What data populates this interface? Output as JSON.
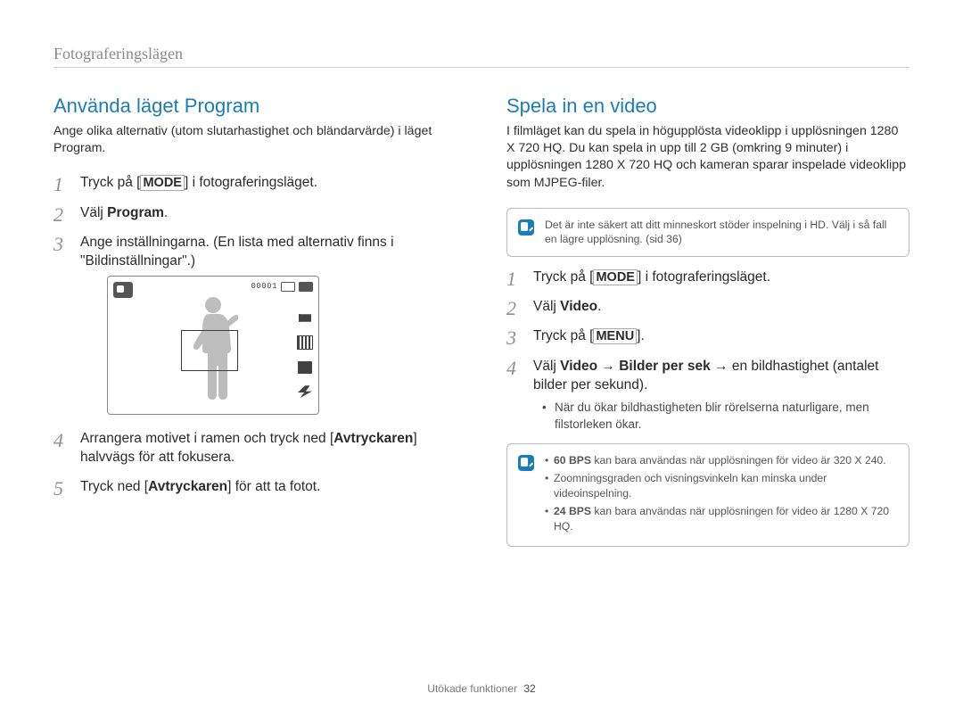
{
  "section_title": "Fotograferingslägen",
  "left": {
    "heading": "Använda läget Program",
    "lead": "Ange olika alternativ (utom slutarhastighet och bländarvärde) i läget Program.",
    "steps": {
      "s1_pre": "Tryck på [",
      "s1_framed": "MODE",
      "s1_post": "] i fotograferingsläget.",
      "s2_pre": "Välj ",
      "s2_bold": "Program",
      "s2_post": ".",
      "s3": "Ange inställningarna. (En lista med alternativ ﬁnns i \"Bildinställningar\".)",
      "s4_pre": "Arrangera motivet i ramen och tryck ned [",
      "s4_bold": "Avtryckaren",
      "s4_post": "] halvvägs för att fokusera.",
      "s5_pre": "Tryck ned [",
      "s5_bold": "Avtryckaren",
      "s5_post": "] för att ta fotot."
    },
    "lcd": {
      "counter": "00001"
    }
  },
  "right": {
    "heading": "Spela in en video",
    "lead": "I ﬁlmläget kan du spela in högupplösta videoklipp i upplösningen 1280 X 720 HQ. Du kan spela in upp till 2 GB (omkring 9 minuter) i upplösningen 1280 X 720 HQ och kameran sparar inspelade videoklipp som MJPEG-ﬁler.",
    "note1": "Det är inte säkert att ditt minneskort stöder inspelning i HD. Välj i så fall en lägre upplösning. (sid 36)",
    "steps": {
      "s1_pre": "Tryck på [",
      "s1_framed": "MODE",
      "s1_post": "] i fotograferingsläget.",
      "s2_pre": "Välj ",
      "s2_bold": "Video",
      "s2_post": ".",
      "s3_pre": "Tryck på [",
      "s3_framed": "MENU",
      "s3_post": "].",
      "s4_pre": "Välj ",
      "s4_b1": "Video",
      "s4_arrow": " → ",
      "s4_b2": "Bilder per sek",
      "s4_post": " → en bildhastighet (antalet bilder per sekund).",
      "s4_sub": "När du ökar bildhastigheten blir rörelserna naturligare, men ﬁlstorleken ökar."
    },
    "note2": {
      "b1_bold": "60 BPS",
      "b1_rest": " kan bara användas när upplösningen för video är 320 X 240.",
      "b2": "Zoomningsgraden och visningsvinkeln kan minska under videoinspelning.",
      "b3_bold": "24 BPS",
      "b3_rest": " kan bara användas när upplösningen för video är 1280 X 720 HQ."
    }
  },
  "footer": {
    "label": "Utökade funktioner",
    "page": "32"
  }
}
